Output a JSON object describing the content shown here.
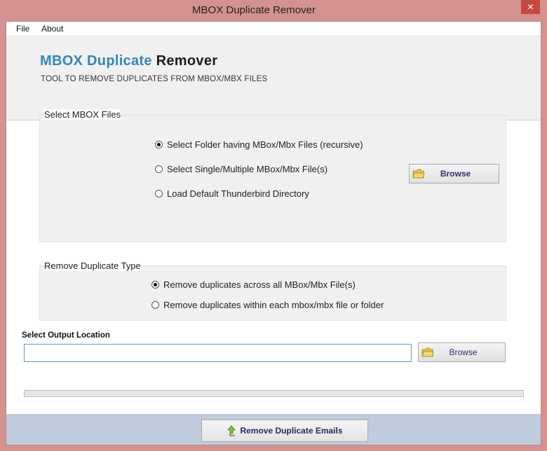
{
  "window": {
    "title": "MBOX Duplicate Remover",
    "close_glyph": "✕"
  },
  "menu": {
    "items": [
      "File",
      "About"
    ]
  },
  "banner": {
    "title_accent": "MBOX Duplicate",
    "title_rest": "Remover",
    "subtitle": "TOOL TO REMOVE DUPLICATES FROM MBOX/MBX FILES"
  },
  "select_files": {
    "label": "Select MBOX Files",
    "options": [
      {
        "label": "Select Folder having MBox/Mbx Files (recursive)",
        "checked": true
      },
      {
        "label": "Select Single/Multiple MBox/Mbx File(s)",
        "checked": false
      },
      {
        "label": "Load Default Thunderbird Directory",
        "checked": false
      }
    ],
    "browse_label": "Browse"
  },
  "duplicate_type": {
    "label": "Remove Duplicate Type",
    "options": [
      {
        "label": "Remove duplicates across all MBox/Mbx File(s)",
        "checked": true
      },
      {
        "label": "Remove duplicates within each mbox/mbx file or folder",
        "checked": false
      }
    ]
  },
  "output": {
    "label": "Select  Output Location",
    "value": "",
    "browse_label": "Browse"
  },
  "progress": {
    "fraction": 0
  },
  "action": {
    "label": "Remove Duplicate Emails"
  },
  "colors": {
    "accent": "#2f88b9",
    "action_text": "#2c2560",
    "browse_text": "#3a2a6a"
  },
  "icons": {
    "folder": "folder-icon",
    "run": "arrow-up-icon",
    "close": "close-icon"
  }
}
